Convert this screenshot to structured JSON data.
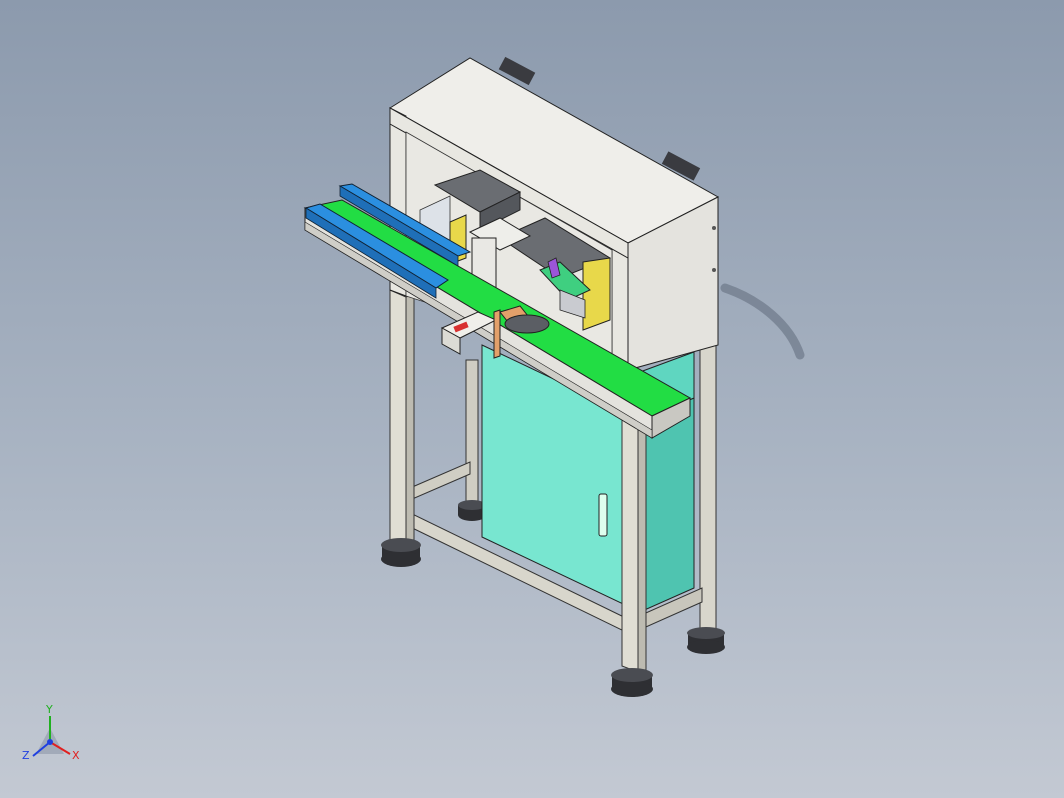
{
  "viewport": {
    "background_top": "#8c9aad",
    "background_bottom": "#c3c9d3"
  },
  "model": {
    "frame_color": "#d8d6cc",
    "cabinet_color": "#78e6d0",
    "conveyor_belt_color": "#22dd44",
    "guide_rail_color": "#2b8fe0",
    "top_housing_color": "#ecebe6",
    "bracket_color": "#e8d84a",
    "foot_color": "#2e2f33"
  },
  "triad": {
    "x_label": "X",
    "y_label": "Y",
    "z_label": "Z",
    "x_color": "#e02020",
    "y_color": "#20b020",
    "z_color": "#2040e0"
  }
}
